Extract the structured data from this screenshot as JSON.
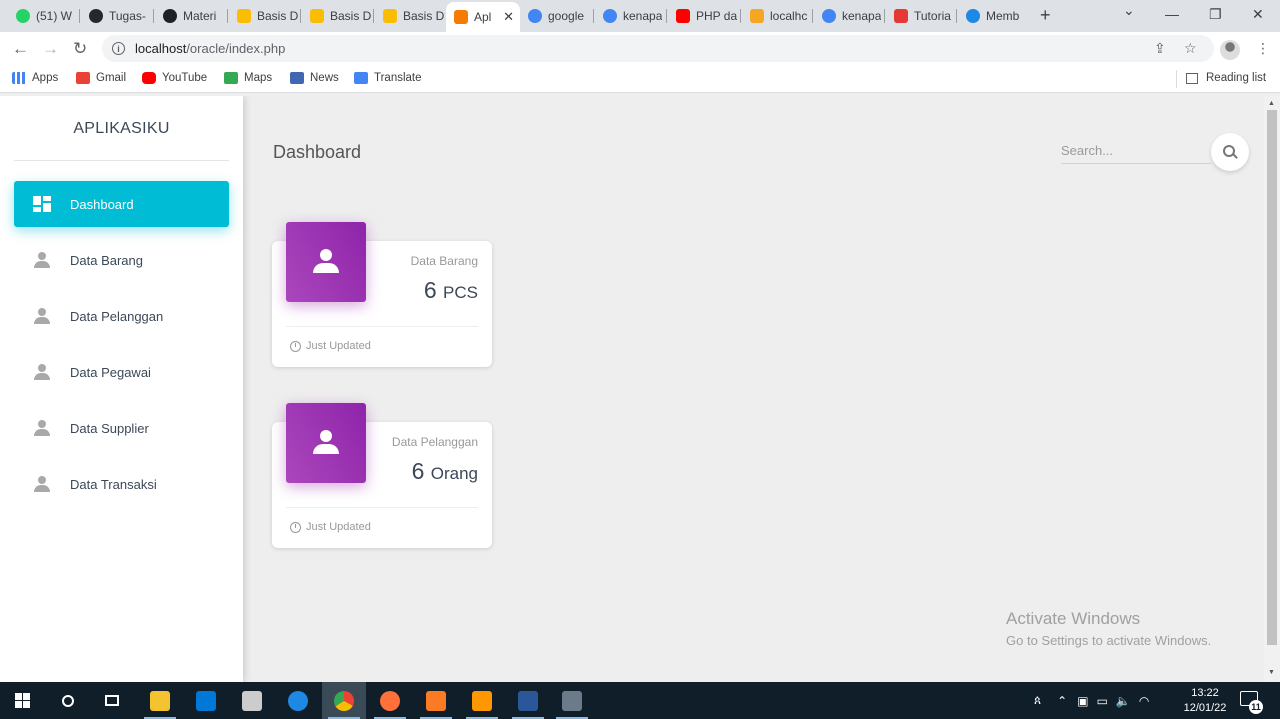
{
  "browser": {
    "tabs": [
      {
        "label": "(51) W",
        "favicon_color": "#25d366"
      },
      {
        "label": "Tugas-",
        "favicon_color": "#24292e"
      },
      {
        "label": "Materi",
        "favicon_color": "#202124"
      },
      {
        "label": "Basis D",
        "favicon_color": "#fbbc04"
      },
      {
        "label": "Basis D",
        "favicon_color": "#fbbc04"
      },
      {
        "label": "Basis D",
        "favicon_color": "#fbbc04"
      },
      {
        "label": "Apl",
        "favicon_color": "#f57c00",
        "active": true
      },
      {
        "label": "google",
        "favicon_color": "#4285f4"
      },
      {
        "label": "kenapa",
        "favicon_color": "#4285f4"
      },
      {
        "label": "PHP da",
        "favicon_color": "#ff0000"
      },
      {
        "label": "localhc",
        "favicon_color": "#f5a623"
      },
      {
        "label": "kenapa",
        "favicon_color": "#4285f4"
      },
      {
        "label": "Tutoria",
        "favicon_color": "#e53935"
      },
      {
        "label": "Memb",
        "favicon_color": "#1e88e5"
      }
    ],
    "tab_close": "✕",
    "new_tab": "+",
    "window_controls": {
      "chevron": "⌄",
      "minimize": "—",
      "restore": "❐",
      "close": "✕"
    },
    "url_host": "localhost",
    "url_path": "/oracle/index.php",
    "bookmarks": [
      {
        "label": "Apps",
        "color": "#4285f4"
      },
      {
        "label": "Gmail",
        "color": "#ea4335"
      },
      {
        "label": "YouTube",
        "color": "#ff0000"
      },
      {
        "label": "Maps",
        "color": "#34a853"
      },
      {
        "label": "News",
        "color": "#4267b2"
      },
      {
        "label": "Translate",
        "color": "#4285f4"
      }
    ],
    "reading_list": "Reading list"
  },
  "sidebar": {
    "brand": "APLIKASIKU",
    "items": [
      {
        "label": "Dashboard",
        "active": true
      },
      {
        "label": "Data Barang"
      },
      {
        "label": "Data Pelanggan"
      },
      {
        "label": "Data Pegawai"
      },
      {
        "label": "Data Supplier"
      },
      {
        "label": "Data Transaksi"
      }
    ]
  },
  "main": {
    "title": "Dashboard",
    "search_placeholder": "Search...",
    "cards": [
      {
        "category": "Data Barang",
        "value": "6",
        "unit": "PCS",
        "footer": "Just Updated"
      },
      {
        "category": "Data Pelanggan",
        "value": "6",
        "unit": "Orang",
        "footer": "Just Updated"
      }
    ],
    "accent_color": "#00bcd4",
    "card_icon_color": "#9c27b0"
  },
  "watermark": {
    "line1": "Activate Windows",
    "line2": "Go to Settings to activate Windows."
  },
  "taskbar": {
    "apps": [
      {
        "name": "file-explorer",
        "color": "#f4c430"
      },
      {
        "name": "mail",
        "color": "#0078d7"
      },
      {
        "name": "store",
        "color": "#cccccc"
      },
      {
        "name": "edge",
        "color": "#1e88e5"
      },
      {
        "name": "chrome",
        "color": "#34a853"
      },
      {
        "name": "firefox",
        "color": "#ff7139"
      },
      {
        "name": "xampp",
        "color": "#fb7a24"
      },
      {
        "name": "sublime",
        "color": "#ff9800"
      },
      {
        "name": "word",
        "color": "#2b579a"
      },
      {
        "name": "terminal",
        "color": "#6b7b8a"
      }
    ],
    "time": "13:22",
    "date": "12/01/22",
    "notification_count": "11"
  }
}
